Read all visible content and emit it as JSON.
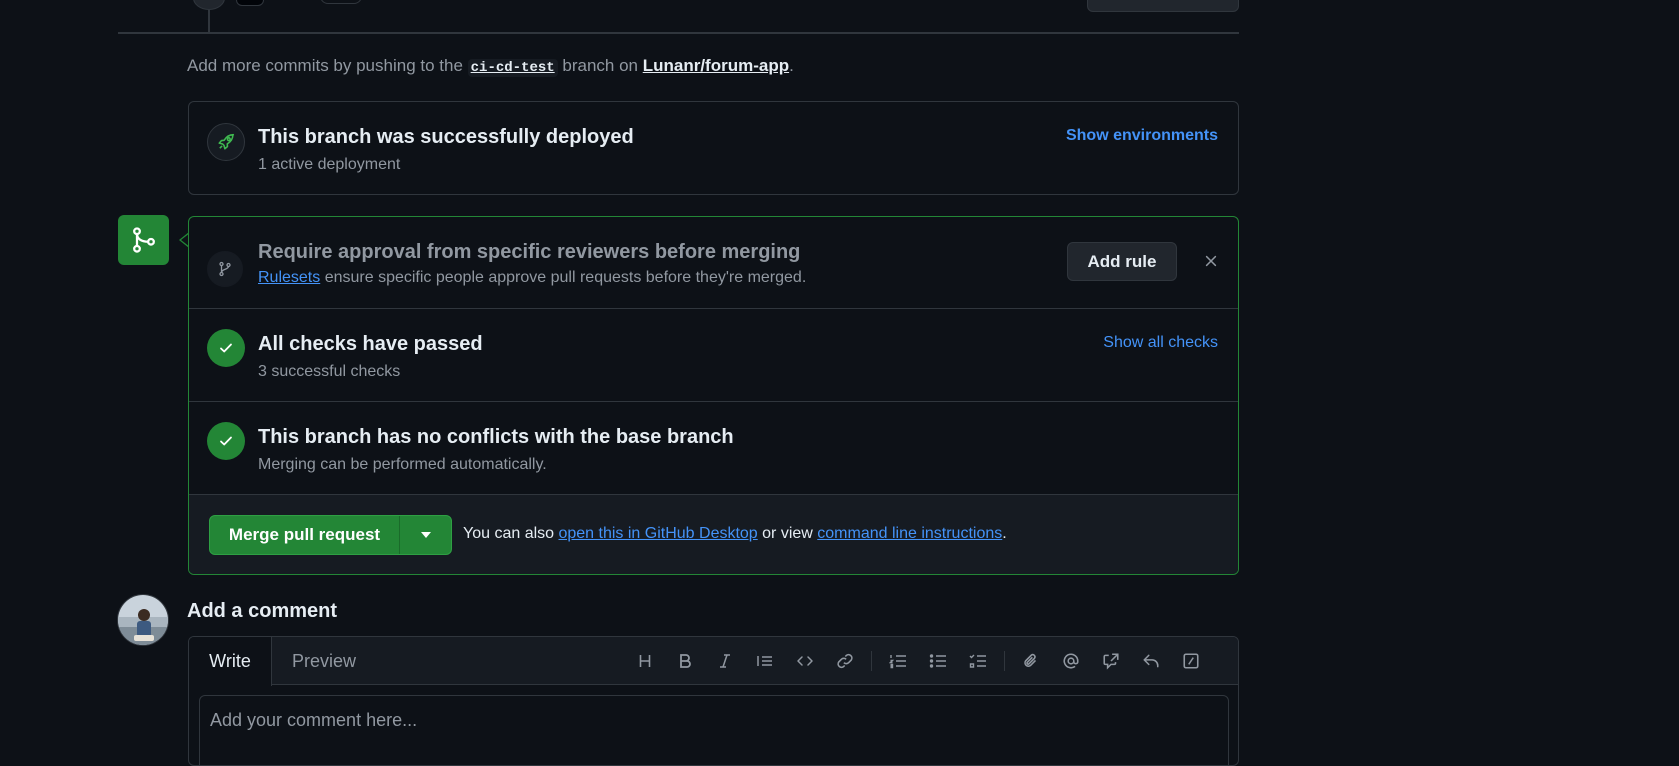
{
  "hint": {
    "prefix": "Add more commits by pushing to the ",
    "branch": "ci-cd-test",
    "middle": " branch on ",
    "repo": "Lunanr/forum-app",
    "suffix": "."
  },
  "deployment": {
    "title": "This branch was successfully deployed",
    "subtitle": "1 active deployment",
    "link": "Show environments"
  },
  "rule": {
    "title": "Require approval from specific reviewers before merging",
    "link": "Rulesets",
    "desc": " ensure specific people approve pull requests before they're merged.",
    "button": "Add rule"
  },
  "checks": {
    "title": "All checks have passed",
    "subtitle": "3 successful checks",
    "link": "Show all checks"
  },
  "conflicts": {
    "title": "This branch has no conflicts with the base branch",
    "subtitle": "Merging can be performed automatically."
  },
  "merge": {
    "button": "Merge pull request",
    "also_prefix": "You can also ",
    "desktop_link": "open this in GitHub Desktop",
    "or_view": " or view ",
    "cli_link": "command line instructions",
    "suffix": "."
  },
  "comment": {
    "heading": "Add a comment",
    "tab_write": "Write",
    "tab_preview": "Preview",
    "placeholder": "Add your comment here..."
  },
  "colors": {
    "success": "#238636",
    "link": "#4493f8",
    "background": "#0d1117"
  },
  "toolbar_icons": [
    "heading-icon",
    "bold-icon",
    "italic-icon",
    "quote-icon",
    "code-icon",
    "link-icon",
    "numbered-list-icon",
    "bulleted-list-icon",
    "task-list-icon",
    "attach-icon",
    "mention-icon",
    "reference-icon",
    "reply-icon",
    "slash-commands-icon"
  ]
}
